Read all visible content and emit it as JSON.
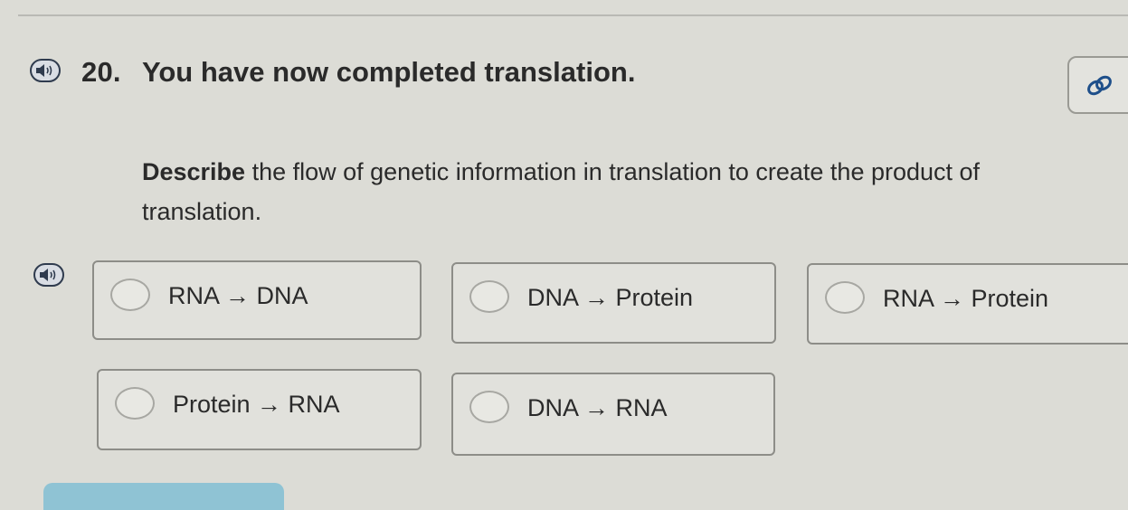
{
  "question": {
    "number": "20.",
    "title": "You have now completed translation.",
    "prompt_bold": "Describe",
    "prompt_rest": " the flow of genetic information in translation to create the product of translation."
  },
  "options": [
    {
      "label": "RNA → DNA"
    },
    {
      "label": "DNA → Protein"
    },
    {
      "label": "RNA → Protein"
    },
    {
      "label": "Protein → RNA"
    },
    {
      "label": "DNA → RNA"
    }
  ],
  "icons": {
    "audio": "speaker-icon",
    "link": "link-icon"
  },
  "colors": {
    "background": "#dcdcd6",
    "accent_button": "#8fc3d4",
    "audio_outline": "#2f3b4e"
  }
}
